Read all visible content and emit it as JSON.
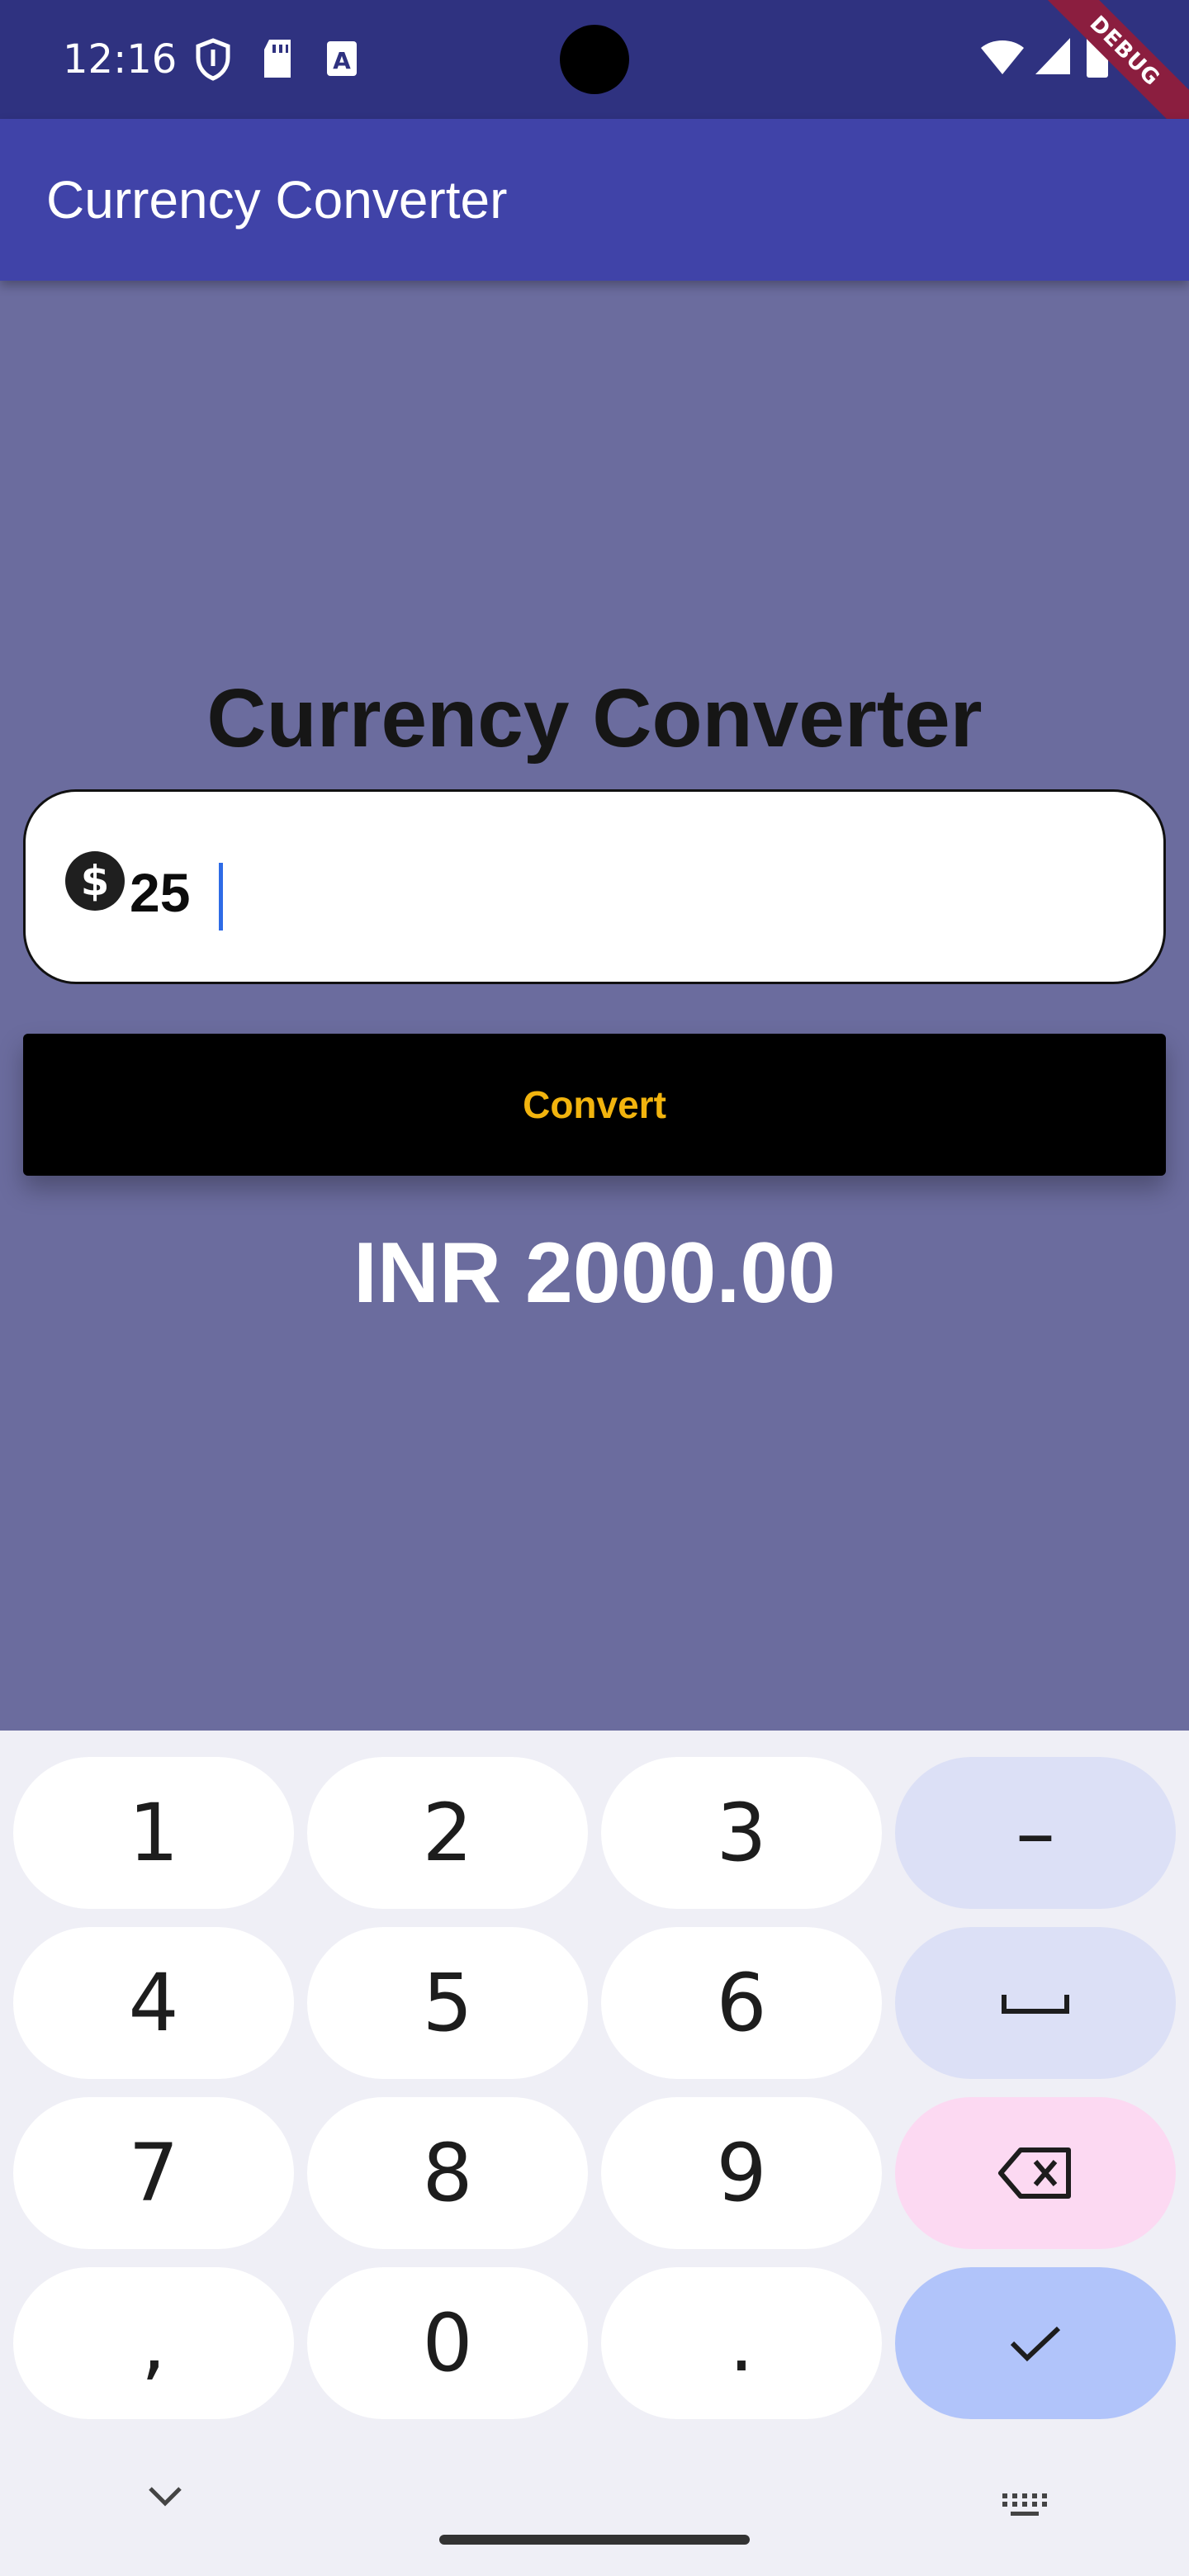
{
  "status_bar": {
    "time": "12:16",
    "left_icons": [
      "shield-icon",
      "sd-card-icon",
      "font-a-icon"
    ],
    "right_icons": [
      "wifi-icon",
      "cell-signal-icon",
      "battery-icon"
    ],
    "debug_banner": "DEBUG"
  },
  "app_bar": {
    "title": "Currency Converter"
  },
  "main": {
    "heading": "Currency Converter",
    "amount_field": {
      "value": "25",
      "icon": "dollar-icon"
    },
    "convert_label": "Convert",
    "result": "INR 2000.00"
  },
  "keyboard": {
    "rows": [
      [
        "1",
        "2",
        "3",
        "–"
      ],
      [
        "4",
        "5",
        "6",
        "space"
      ],
      [
        "7",
        "8",
        "9",
        "backspace"
      ],
      [
        ",",
        "0",
        ".",
        "done"
      ]
    ],
    "bottom_icons": [
      "chevron-down-icon",
      "keyboard-icon"
    ]
  },
  "colors": {
    "status_bar": "#2F3280",
    "app_bar": "#4043A8",
    "background": "#6B6C9E",
    "convert_text": "#F2B40E",
    "convert_bg": "#000000"
  }
}
